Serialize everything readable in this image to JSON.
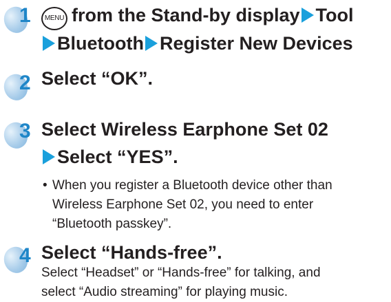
{
  "steps": [
    {
      "number": "1",
      "menu_key": "MENU",
      "line1_text": "from the Stand-by display",
      "line1_tail": "Tool",
      "line2_part1": "Bluetooth",
      "line2_part2": "Register New Devices"
    },
    {
      "number": "2",
      "line1_text": "Select “OK”."
    },
    {
      "number": "3",
      "line1_text": "Select Wireless Earphone Set 02",
      "line2_text": "Select “YES”.",
      "bullet_symbol": "•",
      "bullet_lines": [
        "When you register a Bluetooth device other than",
        "Wireless Earphone Set 02, you need to enter",
        "“Bluetooth passkey”."
      ]
    },
    {
      "number": "4",
      "line1_text": "Select “Hands-free”.",
      "body_lines": [
        "Select “Headset” or “Hands-free” for talking, and",
        "select “Audio streaming” for playing music."
      ]
    }
  ],
  "colors": {
    "step_number": "#1f86c8",
    "arrow": "#1aa0dc",
    "text": "#231f20"
  }
}
